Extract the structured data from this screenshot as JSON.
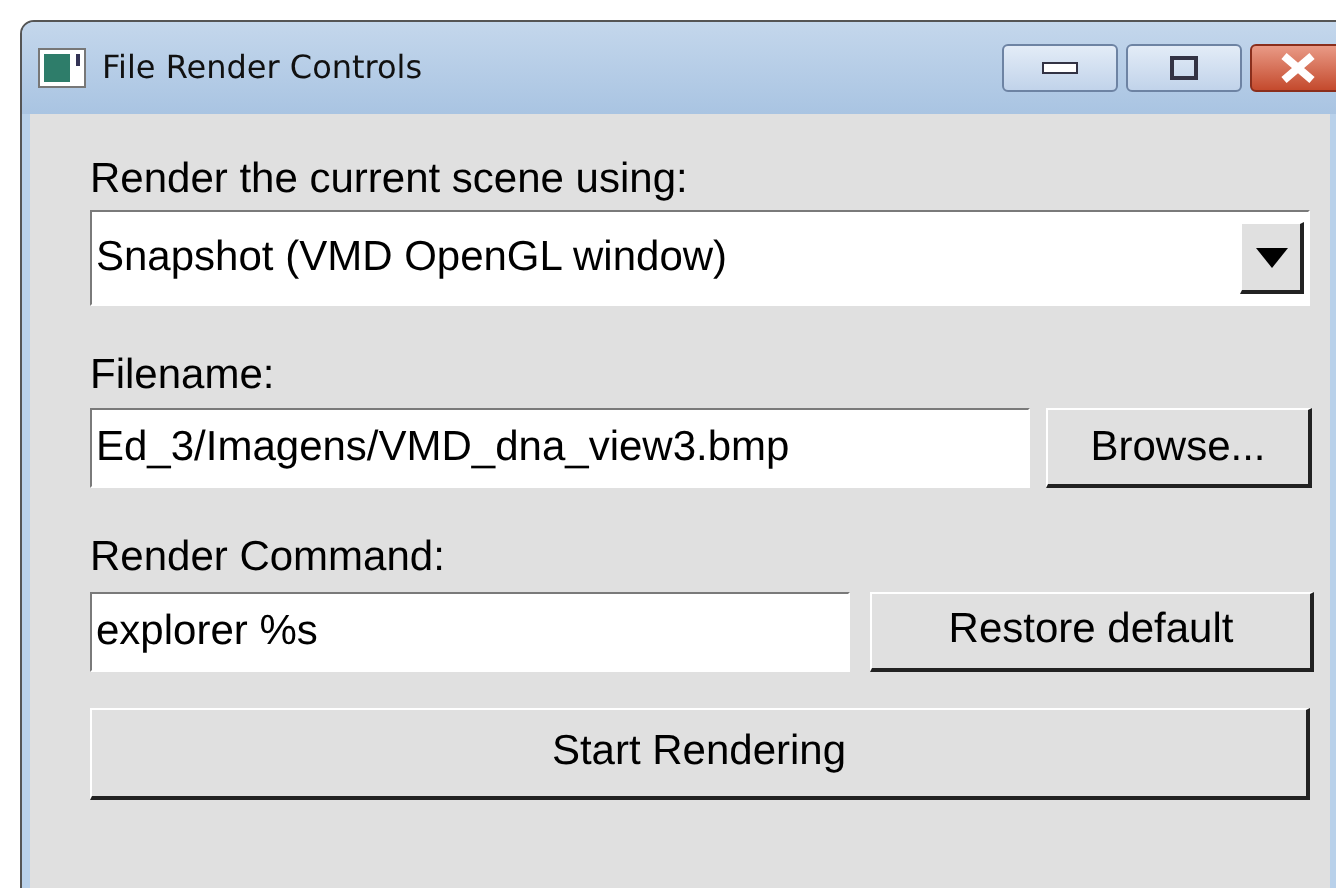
{
  "window": {
    "title": "File Render Controls"
  },
  "renderer": {
    "label": "Render the current scene using:",
    "value": "Snapshot (VMD OpenGL window)"
  },
  "filename": {
    "label": "Filename:",
    "value": "Ed_3/Imagens/VMD_dna_view3.bmp",
    "button": "Browse..."
  },
  "command": {
    "label": "Render Command:",
    "value": "explorer %s",
    "button": "Restore default"
  },
  "start_button": "Start Rendering"
}
